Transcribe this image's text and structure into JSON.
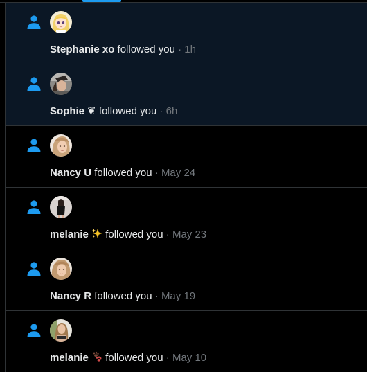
{
  "notifications": [
    {
      "name": "Stephanie xo",
      "action": "followed you",
      "separator": "·",
      "time": "1h",
      "unread": true,
      "emoji": null,
      "icon": "person-follow-icon"
    },
    {
      "name": "Sophie ❦",
      "action": "followed you",
      "separator": "·",
      "time": "6h",
      "unread": true,
      "emoji": null,
      "icon": "person-follow-icon"
    },
    {
      "name": "Nancy U",
      "action": "followed you",
      "separator": "·",
      "time": "May 24",
      "unread": false,
      "emoji": null,
      "icon": "person-follow-icon"
    },
    {
      "name": "melanie",
      "action": "followed you",
      "separator": "·",
      "time": "May 23",
      "unread": false,
      "emoji": "sparkles",
      "icon": "person-follow-icon"
    },
    {
      "name": "Nancy R",
      "action": "followed you",
      "separator": "·",
      "time": "May 19",
      "unread": false,
      "emoji": null,
      "icon": "person-follow-icon"
    },
    {
      "name": "melanie",
      "action": "followed you",
      "separator": "·",
      "time": "May 10",
      "unread": false,
      "emoji": "paw-prints",
      "icon": "person-follow-icon"
    }
  ],
  "colors": {
    "accent": "#1d9bf0",
    "background": "#000000",
    "unread_background": "#0b1725",
    "divider": "#2f3336",
    "text_primary": "#e7e9ea",
    "text_secondary": "#71767b"
  }
}
